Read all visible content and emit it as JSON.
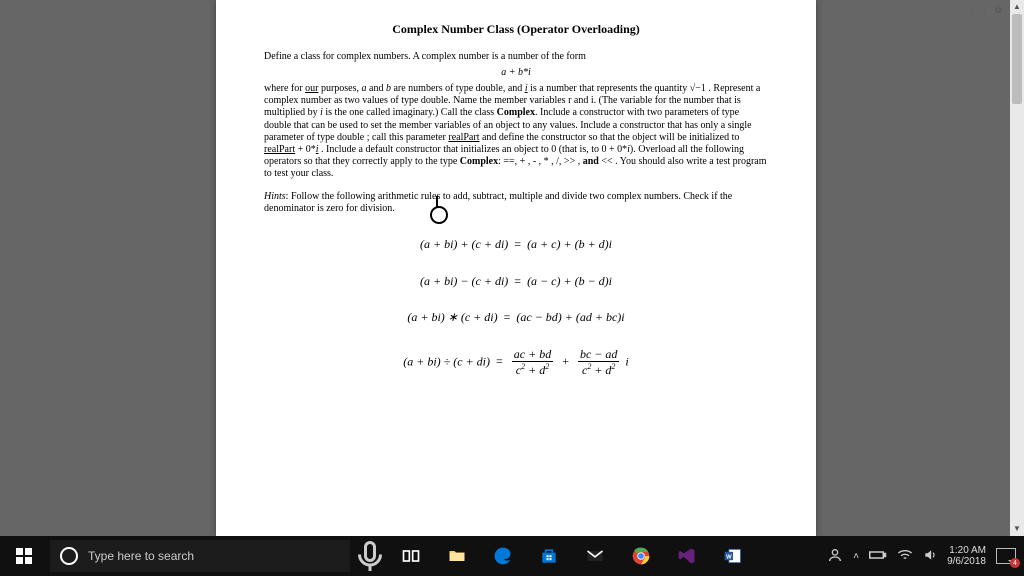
{
  "titlebar": {
    "dots": "· · ·",
    "max": "⧉",
    "close": "✕"
  },
  "doc": {
    "title": "Complex Number Class (Operator Overloading)",
    "intro1": "Define a class for complex numbers. A complex number is a number of the form",
    "form": "a + b*i",
    "intro2a": "where for ",
    "intro2b": "our",
    "intro2c": " purposes, ",
    "intro2d": "a",
    "intro2e": " and ",
    "intro2f": "b",
    "intro2g": " are numbers of type double, and ",
    "intro2h": "i",
    "intro2i": " is a number that represents the quantity √−1 . Represent a complex number as two values of type double. Name the member variables r and i. (The variable for the number that is multiplied by ",
    "intro2j": "i",
    "intro2k": " is the one called imaginary.) Call the class ",
    "intro2l": "Complex",
    "intro2m": ". Include a constructor with two parameters of type double that can be used to set the member variables of an object to any values. Include a constructor that has only a single parameter of type double ; call this parameter ",
    "intro2n": "realPart",
    "intro2o": " and define the constructor so that the object will be initialized to ",
    "intro2p": "realPart",
    "intro2q": " + 0*",
    "intro2r": "i",
    "intro2s": " . Include a default constructor that initializes an object to 0 (that is, to 0 + 0*",
    "intro2t": "i",
    "intro2u": "). Overload all the following operators so that they correctly apply to the type ",
    "intro2v": "Complex",
    "intro2w": ": ==, + , - , * ,  /, >> , ",
    "intro2x": "and",
    "intro2y": " << . You should also write a test program to test your class.",
    "hints_label": "Hints",
    "hints": ": Follow the following arithmetic rules to add, subtract, multiple and divide two complex numbers. Check if the denominator is zero for division.",
    "eq1_l": "(a + bi) + (c + di)",
    "eq1_r": "(a + c) + (b + d)i",
    "eq2_l": "(a + bi) − (c + di)",
    "eq2_r": "(a − c) + (b − d)i",
    "eq3_l": "(a + bi) ∗ (c + di)",
    "eq3_r": "(ac − bd) + (ad + bc)i",
    "eq4_l": "(a + bi) ÷ (c + di)",
    "eq4_num1": "ac + bd",
    "eq4_num2": "bc − ad",
    "eq4_den_a": "c",
    "eq4_den_b": "d",
    "equals": "="
  },
  "taskbar": {
    "search_placeholder": "Type here to search",
    "time": "1:20 AM",
    "date": "9/6/2018",
    "notif_count": "4"
  }
}
